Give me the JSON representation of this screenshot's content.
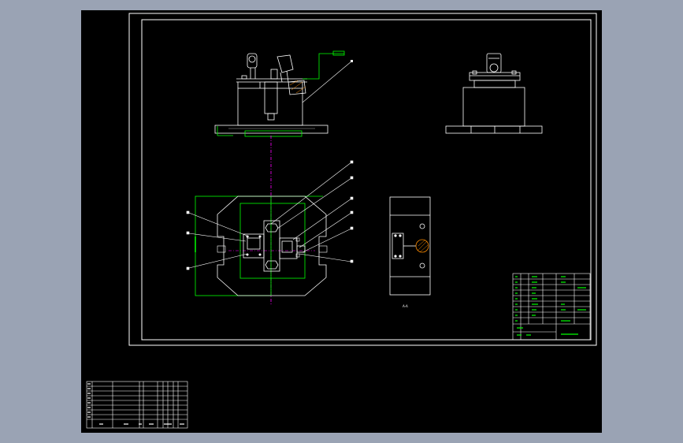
{
  "colors": {
    "viewport_bg": "#9aa3b4",
    "paper": "#000000",
    "line_white": "#ffffff",
    "line_green": "#00ff00",
    "line_magenta": "#ff00ff",
    "line_gray": "#a9a9a9"
  },
  "drawing": {
    "view_label": "A-A",
    "title_block": {
      "rows": 9,
      "columns": 6
    },
    "revision_table": {
      "rows": 9,
      "columns": 9
    },
    "leader_count_plan": 9,
    "leader_count_front": 1
  },
  "icons": {
    "balloon": "leader-balloon-icon",
    "bolt": "hex-bolt-icon",
    "clamp": "swing-clamp-icon"
  }
}
